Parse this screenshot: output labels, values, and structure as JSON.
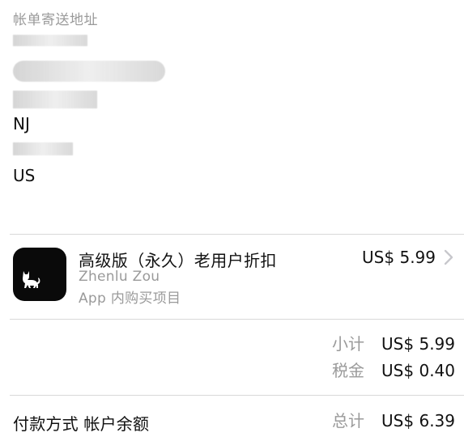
{
  "billing": {
    "title": "帐单寄送地址",
    "state": "NJ",
    "country": "US"
  },
  "purchase": {
    "title": "高级版（永久）老用户折扣",
    "developer": "Zhenlu Zou",
    "type": "App 内购买项目",
    "price": "US$ 5.99",
    "icon": "cat-icon"
  },
  "summary": {
    "subtotal_label": "小计",
    "subtotal_value": "US$ 5.99",
    "tax_label": "税金",
    "tax_value": "US$ 0.40",
    "payment_method": "付款方式 帐户余额",
    "total_label": "总计",
    "total_value": "US$ 6.39"
  }
}
